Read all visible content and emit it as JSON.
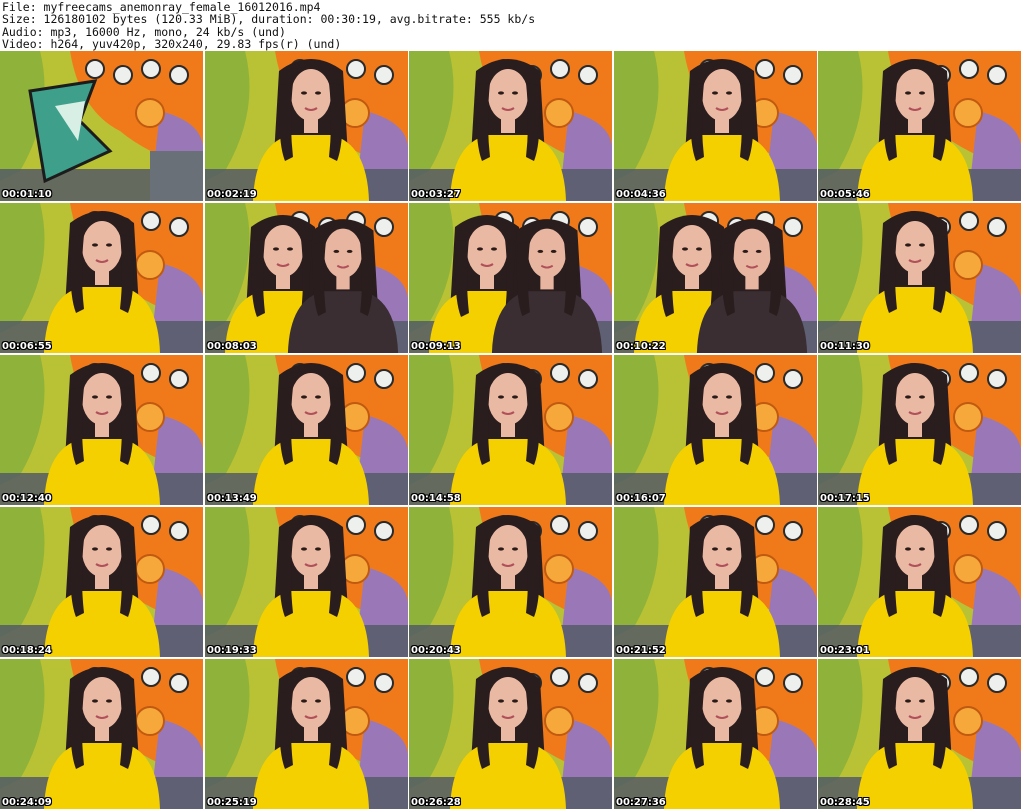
{
  "header": {
    "file_line": "File: myfreecams_anemonray_female_16012016.mp4",
    "size_line": "Size: 126180102 bytes (120.33 MiB), duration: 00:30:19, avg.bitrate: 555 kb/s",
    "audio_line": "Audio: mp3, 16000 Hz, mono, 24 kb/s (und)",
    "video_line": "Video: h264, yuv420p, 320x240, 29.83 fps(r) (und)"
  },
  "thumbnails": [
    {
      "time": "00:01:10",
      "scene": "graffiti"
    },
    {
      "time": "00:02:19",
      "scene": "solo"
    },
    {
      "time": "00:03:27",
      "scene": "solo"
    },
    {
      "time": "00:04:36",
      "scene": "solo"
    },
    {
      "time": "00:05:46",
      "scene": "solo"
    },
    {
      "time": "00:06:55",
      "scene": "solo"
    },
    {
      "time": "00:08:03",
      "scene": "duo"
    },
    {
      "time": "00:09:13",
      "scene": "duo"
    },
    {
      "time": "00:10:22",
      "scene": "duo"
    },
    {
      "time": "00:11:30",
      "scene": "solo"
    },
    {
      "time": "00:12:40",
      "scene": "solo"
    },
    {
      "time": "00:13:49",
      "scene": "solo"
    },
    {
      "time": "00:14:58",
      "scene": "solo"
    },
    {
      "time": "00:16:07",
      "scene": "solo"
    },
    {
      "time": "00:17:15",
      "scene": "solo"
    },
    {
      "time": "00:18:24",
      "scene": "solo"
    },
    {
      "time": "00:19:33",
      "scene": "solo"
    },
    {
      "time": "00:20:43",
      "scene": "solo"
    },
    {
      "time": "00:21:52",
      "scene": "solo"
    },
    {
      "time": "00:23:01",
      "scene": "solo"
    },
    {
      "time": "00:24:09",
      "scene": "solo"
    },
    {
      "time": "00:25:19",
      "scene": "solo"
    },
    {
      "time": "00:26:28",
      "scene": "solo"
    },
    {
      "time": "00:27:36",
      "scene": "solo"
    },
    {
      "time": "00:28:45",
      "scene": "solo"
    }
  ],
  "colors": {
    "background": "#ffffff",
    "graffiti_green": "#b8c234",
    "graffiti_orange": "#f07a1a",
    "graffiti_purple": "#9a78b8",
    "top_yellow": "#f4d000",
    "hair": "#2a1d1e",
    "skin": "#eab9a3",
    "sofa": "#555c66"
  }
}
